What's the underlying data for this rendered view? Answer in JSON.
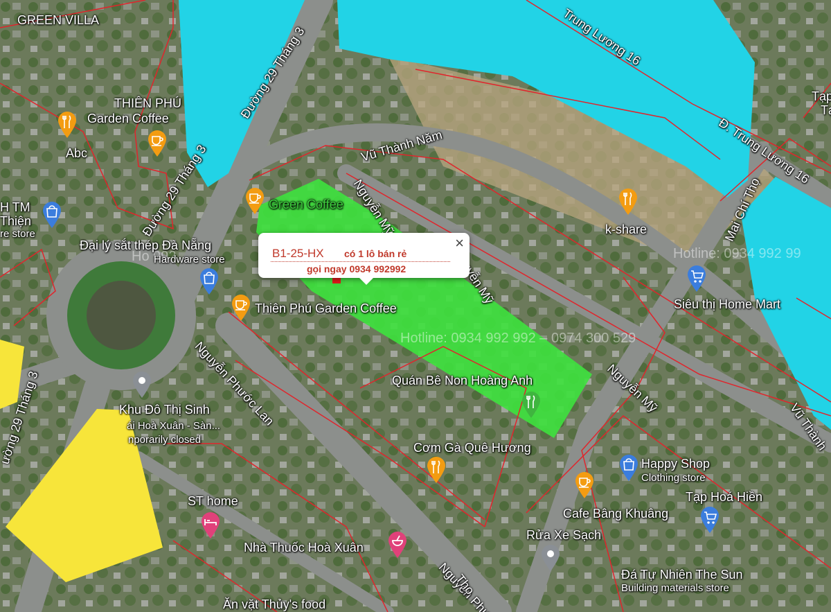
{
  "map": {
    "colors": {
      "parcel_fill": "#3ee23e",
      "water": "#22d3e6",
      "yellow_zone": "#f7e53a",
      "boundary": "#e0252c",
      "pin_food": "#f39c12",
      "pin_shop": "#3b7ddd",
      "pin_grey": "#8a8f95",
      "pin_pink": "#e0417a"
    },
    "popup": {
      "code": "B1-25-HX",
      "description": "có 1 lô bán rẻ",
      "phone": "gọi ngay 0934 992992",
      "close_label": "×"
    },
    "watermarks": {
      "center": "Hotline: 0934 992 992 – 0974 300 529",
      "right": "Hotline: 0934 992 99",
      "left": "Ho 992"
    },
    "roads": {
      "duong_29_thang_3_a": "Đường 29 Tháng 3",
      "duong_29_thang_3_b": "Đường 29 Tháng 3",
      "duong_29_thang_3_c": "ường 29 Tháng 3",
      "vu_thanh_nam": "Vũ Thành Năm",
      "nguyen_my_a": "Nguyễn Mỹ",
      "nguyen_my_b": "guyễn Mỹ",
      "nguyen_my_c": "Nguyễn Mỹ",
      "trung_luong_16_a": "Trung Lương 16",
      "trung_luong_16_b": "Đ. Trung Lương 16",
      "mai_chi_tho": "Mai Chí Thọ",
      "nguyen_phuoc_lan": "Nguyễn Phước Lan",
      "nguyen_phu": "Nguyễn Phư",
      "vu_thanh": "Vũ Thành",
      "tho": "Thọ"
    },
    "places": {
      "green_villa": "GREEN VILLA",
      "thien_phu_top": "THIÊN PHÚ",
      "garden_coffee": "Garden Coffee",
      "abc": "Abc",
      "green_coffee": "Green Coffee",
      "tm_line1": "H TM",
      "tm_line2": "Thiện",
      "tm_line3": "re store",
      "dai_ly": "Đại lý sắt thép Đà Nẵng",
      "hardware": "Hardware store",
      "thien_phu_garden": "Thiên Phú Garden Coffee",
      "k_share": "k-share",
      "sieu_thi": "Siêu thị Home Mart",
      "quan_be": "Quán Bê Non Hoàng Anh",
      "khu_do_thi_1": "Khu Đô Thị Sinh",
      "khu_do_thi_2": "ái Hoà Xuân -  Sàn...",
      "khu_do_thi_3": "nporarily closed",
      "com_ga": "Cơm Gà Quê Hương",
      "happy_shop": "Happy Shop",
      "clothing": "Clothing store",
      "tap_hoa": "Tạp Hoá Hiền",
      "cafe_bang": "Cafe Bâng Khuâng",
      "rua_xe": "Rửa Xe Sạch",
      "st_home": "ST home",
      "nha_thuoc": "Nhà Thuốc Hoà Xuân",
      "da_tu_nhien": "Đá Tự Nhiên The Sun",
      "building_materials": "Building materials store",
      "an_vat": "Ăn vặt Thủy's food",
      "tap_right": "Tạp",
      "tap_right2": "Tạ"
    },
    "icons": {
      "food": "fork-knife-icon",
      "coffee": "coffee-cup-icon",
      "shop": "shopping-bag-icon",
      "cart": "shopping-cart-icon",
      "pin": "map-pin-icon",
      "bed": "bed-icon",
      "pharmacy": "mortar-pestle-icon"
    }
  }
}
